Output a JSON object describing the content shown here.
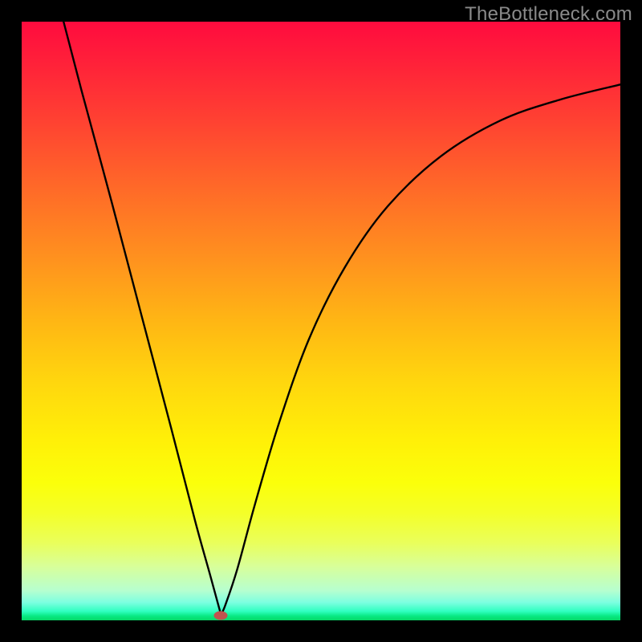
{
  "watermark": "TheBottleneck.com",
  "marker": {
    "x_frac": 0.333,
    "y_frac": 0.992
  },
  "colors": {
    "frame": "#000000",
    "curve": "#000000",
    "marker": "#c1524e",
    "gradient_top": "#ff0b3e",
    "gradient_bottom": "#06d868"
  },
  "chart_data": {
    "type": "line",
    "title": "",
    "xlabel": "",
    "ylabel": "",
    "xlim": [
      0,
      1
    ],
    "ylim": [
      0,
      1
    ],
    "note": "Axes are unlabeled in source; x and y are normalized 0–1 by plot extent. Curve is a V-shaped bottleneck curve with vertex near x≈0.33.",
    "series": [
      {
        "name": "bottleneck-curve",
        "x": [
          0.07,
          0.1,
          0.15,
          0.2,
          0.25,
          0.29,
          0.315,
          0.33,
          0.333,
          0.34,
          0.36,
          0.39,
          0.43,
          0.48,
          0.54,
          0.61,
          0.7,
          0.8,
          0.9,
          1.0
        ],
        "y": [
          1.0,
          0.885,
          0.7,
          0.51,
          0.32,
          0.165,
          0.075,
          0.02,
          0.01,
          0.025,
          0.085,
          0.195,
          0.33,
          0.47,
          0.59,
          0.69,
          0.775,
          0.835,
          0.87,
          0.895
        ]
      }
    ],
    "markers": [
      {
        "name": "optimum",
        "x": 0.333,
        "y": 0.008
      }
    ]
  }
}
